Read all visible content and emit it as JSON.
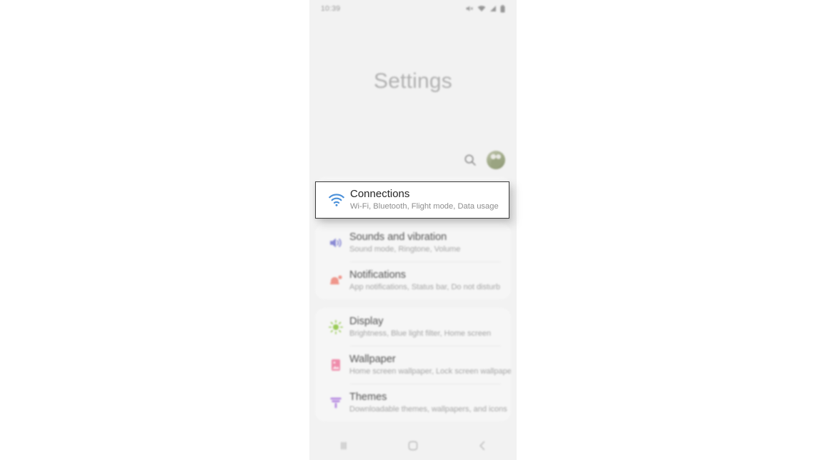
{
  "status_bar": {
    "time": "10:39",
    "icons": [
      "mute-icon",
      "wifi-icon",
      "signal-icon",
      "battery-icon"
    ]
  },
  "header": {
    "title": "Settings",
    "search_icon": "search-icon",
    "avatar": "profile-avatar"
  },
  "focused_item": {
    "icon": "wifi-icon",
    "icon_color": "#4a90d9",
    "title": "Connections",
    "subtitle": "Wi-Fi, Bluetooth, Flight mode, Data usage"
  },
  "groups": [
    {
      "rows": [
        {
          "icon": "volume-icon",
          "icon_color": "#7b7bd0",
          "title": "Sounds and vibration",
          "subtitle": "Sound mode, Ringtone, Volume"
        },
        {
          "icon": "notification-icon",
          "icon_color": "#ef8a7d",
          "title": "Notifications",
          "subtitle": "App notifications, Status bar, Do not disturb"
        }
      ]
    },
    {
      "rows": [
        {
          "icon": "brightness-icon",
          "icon_color": "#8ec641",
          "title": "Display",
          "subtitle": "Brightness, Blue light filter, Home screen"
        },
        {
          "icon": "wallpaper-icon",
          "icon_color": "#ef7fa2",
          "title": "Wallpaper",
          "subtitle": "Home screen wallpaper, Lock screen wallpaper"
        },
        {
          "icon": "themes-icon",
          "icon_color": "#b07fe0",
          "title": "Themes",
          "subtitle": "Downloadable themes, wallpapers, and icons"
        }
      ]
    }
  ],
  "nav_bar": {
    "recents_label": "recents-icon",
    "home_label": "home-icon",
    "back_label": "back-icon"
  },
  "colors": {
    "phone_background": "#f2f2f2",
    "card_background": "#f7f7f7",
    "focus_border": "#3a3a3a",
    "page_background": "#ffffff"
  }
}
